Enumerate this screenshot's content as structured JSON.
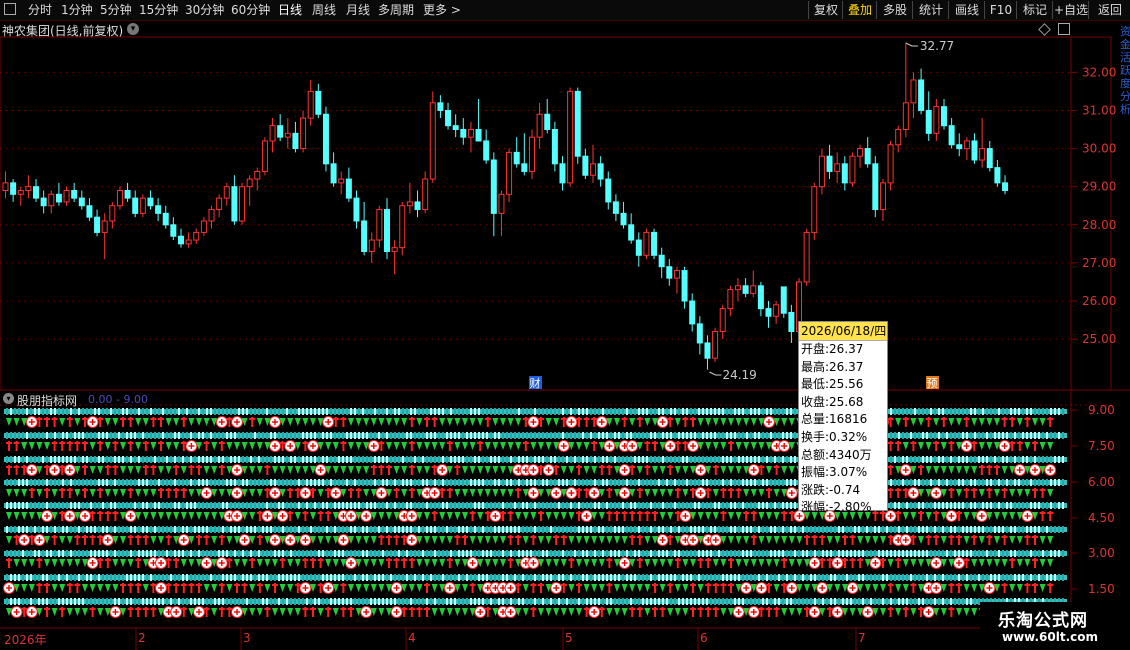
{
  "toolbar": {
    "left_items": [
      "分时",
      "1分钟",
      "5分钟",
      "15分钟",
      "30分钟",
      "60分钟",
      "日线",
      "周线",
      "月线",
      "多周期",
      "更多 >"
    ],
    "active_left": "日线",
    "right_items": [
      "复权",
      "叠加",
      "多股",
      "统计",
      "画线",
      "F10",
      "标记",
      "+自选",
      "返回"
    ],
    "active_right": "叠加"
  },
  "chart": {
    "title": "神农集团(日线,前复权)",
    "price_axis": [
      "32.00",
      "31.00",
      "30.00",
      "29.00",
      "28.00",
      "27.00",
      "26.00",
      "25.00"
    ],
    "high_label": "32.77",
    "low_label": "24.19",
    "markers": [
      "财",
      "预"
    ],
    "colors": {
      "up": "#ff3232",
      "down": "#54ffff",
      "grid": "#7a0000",
      "axis_text": "#d33"
    }
  },
  "indicator": {
    "name": "股朋指标网",
    "range": "0.00 - 9.00",
    "axis": [
      "9.00",
      "7.50",
      "6.00",
      "4.50",
      "3.00",
      "1.50"
    ]
  },
  "tooltip": {
    "date": "2026/06/18/四",
    "rows": [
      "开盘:26.37",
      "最高:26.37",
      "最低:25.56",
      "收盘:25.68",
      "总量:16816",
      "换手:0.32%",
      "总额:4340万",
      "振幅:3.07%",
      "涨跌:-0.74",
      "涨幅:-2.80%"
    ]
  },
  "date_axis": {
    "year": "2026年",
    "months": [
      "2",
      "3",
      "4",
      "5",
      "6",
      "7"
    ]
  },
  "side_text": "资金活跃度分析",
  "watermark": {
    "title": "乐淘公式网",
    "url": "www.60lt.com"
  },
  "chart_data": {
    "type": "candlestick",
    "ylim": [
      24.19,
      32.77
    ],
    "ohlc": [
      [
        28.9,
        29.4,
        28.7,
        29.1
      ],
      [
        29.1,
        29.2,
        28.6,
        28.8
      ],
      [
        28.8,
        29.0,
        28.5,
        28.9
      ],
      [
        28.9,
        29.3,
        28.7,
        29.0
      ],
      [
        29.0,
        29.2,
        28.6,
        28.7
      ],
      [
        28.7,
        28.9,
        28.3,
        28.5
      ],
      [
        28.5,
        28.9,
        28.3,
        28.8
      ],
      [
        28.8,
        29.1,
        28.5,
        28.6
      ],
      [
        28.6,
        29.0,
        28.5,
        28.9
      ],
      [
        28.9,
        29.1,
        28.6,
        28.7
      ],
      [
        28.7,
        28.9,
        28.4,
        28.5
      ],
      [
        28.5,
        28.7,
        28.1,
        28.2
      ],
      [
        28.2,
        28.4,
        27.7,
        27.8
      ],
      [
        27.8,
        28.3,
        27.1,
        28.1
      ],
      [
        28.1,
        28.6,
        27.9,
        28.5
      ],
      [
        28.5,
        29.0,
        28.4,
        28.9
      ],
      [
        28.9,
        29.1,
        28.6,
        28.7
      ],
      [
        28.7,
        28.9,
        28.2,
        28.3
      ],
      [
        28.3,
        28.8,
        28.2,
        28.7
      ],
      [
        28.7,
        28.9,
        28.4,
        28.5
      ],
      [
        28.5,
        28.7,
        28.1,
        28.3
      ],
      [
        28.3,
        28.5,
        27.9,
        28.0
      ],
      [
        28.0,
        28.2,
        27.6,
        27.7
      ],
      [
        27.7,
        27.9,
        27.4,
        27.5
      ],
      [
        27.5,
        27.8,
        27.4,
        27.6
      ],
      [
        27.6,
        27.9,
        27.5,
        27.8
      ],
      [
        27.8,
        28.2,
        27.7,
        28.1
      ],
      [
        28.1,
        28.5,
        27.9,
        28.4
      ],
      [
        28.4,
        28.8,
        28.2,
        28.7
      ],
      [
        28.7,
        29.1,
        28.5,
        29.0
      ],
      [
        29.0,
        29.3,
        28.0,
        28.1
      ],
      [
        28.1,
        29.1,
        28.0,
        29.0
      ],
      [
        29.0,
        29.3,
        28.5,
        29.2
      ],
      [
        29.2,
        29.5,
        28.9,
        29.4
      ],
      [
        29.4,
        30.3,
        29.3,
        30.2
      ],
      [
        30.2,
        30.8,
        29.9,
        30.6
      ],
      [
        30.6,
        30.9,
        30.2,
        30.3
      ],
      [
        30.3,
        30.8,
        30.0,
        30.4
      ],
      [
        30.4,
        30.7,
        29.9,
        30.0
      ],
      [
        30.0,
        31.0,
        29.9,
        30.8
      ],
      [
        30.8,
        31.8,
        30.6,
        31.5
      ],
      [
        31.5,
        31.7,
        30.8,
        30.9
      ],
      [
        30.9,
        31.1,
        29.4,
        29.6
      ],
      [
        29.6,
        29.9,
        29.0,
        29.1
      ],
      [
        29.1,
        29.4,
        28.8,
        29.2
      ],
      [
        29.2,
        29.5,
        28.6,
        28.7
      ],
      [
        28.7,
        28.9,
        27.9,
        28.1
      ],
      [
        28.1,
        28.6,
        27.2,
        27.3
      ],
      [
        27.3,
        27.8,
        27.0,
        27.6
      ],
      [
        27.6,
        28.5,
        27.4,
        28.4
      ],
      [
        28.4,
        28.7,
        27.1,
        27.3
      ],
      [
        27.3,
        27.6,
        26.7,
        27.4
      ],
      [
        27.4,
        28.6,
        27.2,
        28.5
      ],
      [
        28.5,
        29.1,
        28.3,
        28.6
      ],
      [
        28.6,
        28.9,
        28.2,
        28.4
      ],
      [
        28.4,
        29.4,
        28.3,
        29.2
      ],
      [
        29.2,
        31.5,
        29.1,
        31.2
      ],
      [
        31.2,
        31.4,
        30.8,
        31.0
      ],
      [
        31.0,
        31.2,
        30.5,
        30.6
      ],
      [
        30.6,
        30.9,
        30.3,
        30.5
      ],
      [
        30.5,
        30.8,
        30.1,
        30.3
      ],
      [
        30.3,
        30.7,
        29.9,
        30.5
      ],
      [
        30.5,
        31.3,
        30.4,
        30.2
      ],
      [
        30.2,
        30.5,
        29.6,
        29.7
      ],
      [
        29.7,
        29.9,
        27.7,
        28.3
      ],
      [
        28.3,
        28.9,
        27.7,
        28.8
      ],
      [
        28.8,
        30.0,
        28.6,
        29.9
      ],
      [
        29.9,
        30.3,
        29.5,
        29.6
      ],
      [
        29.6,
        30.4,
        29.3,
        29.4
      ],
      [
        29.4,
        30.5,
        29.2,
        30.3
      ],
      [
        30.3,
        31.2,
        30.0,
        30.9
      ],
      [
        30.9,
        31.3,
        30.4,
        30.5
      ],
      [
        30.5,
        30.7,
        29.4,
        29.6
      ],
      [
        29.6,
        29.8,
        28.9,
        29.1
      ],
      [
        29.1,
        31.6,
        29.0,
        31.5
      ],
      [
        31.5,
        31.6,
        29.6,
        29.8
      ],
      [
        29.8,
        30.0,
        29.2,
        29.3
      ],
      [
        29.3,
        30.1,
        29.1,
        29.6
      ],
      [
        29.6,
        29.8,
        29.0,
        29.2
      ],
      [
        29.2,
        29.4,
        28.4,
        28.6
      ],
      [
        28.6,
        28.8,
        28.1,
        28.3
      ],
      [
        28.3,
        28.6,
        27.9,
        28.0
      ],
      [
        28.0,
        28.3,
        27.5,
        27.6
      ],
      [
        27.6,
        27.8,
        26.9,
        27.2
      ],
      [
        27.2,
        27.9,
        27.1,
        27.8
      ],
      [
        27.8,
        27.9,
        27.1,
        27.2
      ],
      [
        27.2,
        27.4,
        26.6,
        26.9
      ],
      [
        26.9,
        27.1,
        26.4,
        26.6
      ],
      [
        26.6,
        26.9,
        26.2,
        26.8
      ],
      [
        26.8,
        26.9,
        25.8,
        26.0
      ],
      [
        26.0,
        26.2,
        25.2,
        25.4
      ],
      [
        25.4,
        25.6,
        24.6,
        24.9
      ],
      [
        24.9,
        25.1,
        24.2,
        24.5
      ],
      [
        24.5,
        25.3,
        24.4,
        25.2
      ],
      [
        25.2,
        25.9,
        25.0,
        25.8
      ],
      [
        25.8,
        26.4,
        25.6,
        26.3
      ],
      [
        26.3,
        26.6,
        26.0,
        26.4
      ],
      [
        26.4,
        26.6,
        26.1,
        26.2
      ],
      [
        26.2,
        26.8,
        26.1,
        26.4
      ],
      [
        26.4,
        26.5,
        25.6,
        25.8
      ],
      [
        25.8,
        26.0,
        25.3,
        25.6
      ],
      [
        25.6,
        26.0,
        25.4,
        25.9
      ],
      [
        26.37,
        26.37,
        25.56,
        25.68
      ],
      [
        25.7,
        25.9,
        24.9,
        25.2
      ],
      [
        25.2,
        26.6,
        25.1,
        26.5
      ],
      [
        26.5,
        27.9,
        26.4,
        27.8
      ],
      [
        27.8,
        29.1,
        27.6,
        29.0
      ],
      [
        29.0,
        30.0,
        28.8,
        29.8
      ],
      [
        29.8,
        30.1,
        29.2,
        29.4
      ],
      [
        29.4,
        29.9,
        29.1,
        29.6
      ],
      [
        29.6,
        29.8,
        28.9,
        29.1
      ],
      [
        29.1,
        29.9,
        29.0,
        29.8
      ],
      [
        29.8,
        30.1,
        29.5,
        30.0
      ],
      [
        30.0,
        30.3,
        29.5,
        29.6
      ],
      [
        29.6,
        29.8,
        28.2,
        28.4
      ],
      [
        28.4,
        29.2,
        28.1,
        29.1
      ],
      [
        29.1,
        30.2,
        28.9,
        30.1
      ],
      [
        30.1,
        30.6,
        29.9,
        30.5
      ],
      [
        30.5,
        32.77,
        30.3,
        31.2
      ],
      [
        31.2,
        32.0,
        30.8,
        31.8
      ],
      [
        31.8,
        32.1,
        30.9,
        31.0
      ],
      [
        31.0,
        31.5,
        30.2,
        30.4
      ],
      [
        30.4,
        31.3,
        30.2,
        31.1
      ],
      [
        31.1,
        31.3,
        30.5,
        30.6
      ],
      [
        30.6,
        30.8,
        30.0,
        30.1
      ],
      [
        30.1,
        30.4,
        29.8,
        30.0
      ],
      [
        30.0,
        30.3,
        29.7,
        30.2
      ],
      [
        30.2,
        30.4,
        29.6,
        29.7
      ],
      [
        29.7,
        30.8,
        29.5,
        30.0
      ],
      [
        30.0,
        30.2,
        29.4,
        29.5
      ],
      [
        29.5,
        29.7,
        29.0,
        29.1
      ],
      [
        29.1,
        29.3,
        28.8,
        28.9
      ]
    ]
  }
}
